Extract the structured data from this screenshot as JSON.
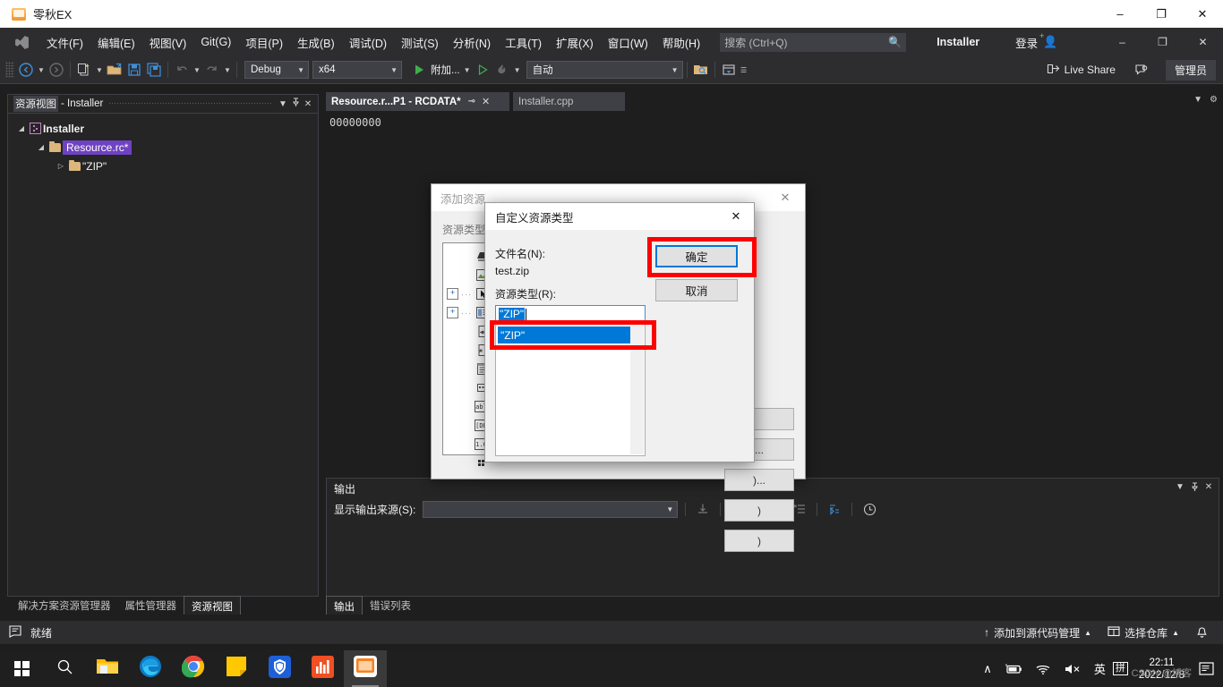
{
  "window": {
    "title": "零秋EX",
    "app_icon": "app-window-icon",
    "minimize": "–",
    "maximize": "❐",
    "close": "✕"
  },
  "menubar": {
    "logo": "visual-studio-logo",
    "items": [
      "文件(F)",
      "编辑(E)",
      "视图(V)",
      "Git(G)",
      "项目(P)",
      "生成(B)",
      "调试(D)",
      "测试(S)",
      "分析(N)",
      "工具(T)",
      "扩展(X)",
      "窗口(W)",
      "帮助(H)"
    ],
    "search_placeholder": "搜索 (Ctrl+Q)",
    "search_icon": "search-icon",
    "project_name": "Installer",
    "signin": "登录",
    "signin_icon": "account-add-icon",
    "minimize": "–",
    "restore": "❐",
    "close": "✕"
  },
  "toolbar": {
    "nav_back_icon": "navigate-back-icon",
    "nav_forward_icon": "navigate-forward-icon",
    "new_item_icon": "new-item-icon",
    "open_file_icon": "open-file-icon",
    "save_icon": "save-icon",
    "save_all_icon": "save-all-icon",
    "undo_icon": "undo-icon",
    "redo_icon": "redo-icon",
    "configuration": "Debug",
    "platform": "x64",
    "start_icon": "start-debug-icon",
    "attach_label": "附加...",
    "start_outline_icon": "start-without-debug-icon",
    "hotreload_icon": "hot-reload-icon",
    "auto_label": "自动",
    "search_folder_icon": "search-folder-icon",
    "window_layout_icon": "window-layout-icon",
    "overflow_icon": "toolbar-overflow-icon",
    "live_share": "Live Share",
    "live_share_icon": "live-share-icon",
    "feedback_icon": "feedback-icon",
    "admin_badge": "管理员"
  },
  "resource_view": {
    "tab_title": "资源视图",
    "tab_suffix": "- Installer",
    "dropdown_icon": "▼",
    "pin_icon": "▮",
    "close_icon": "✕",
    "tree": [
      {
        "label": "Installer",
        "expander": "◢",
        "icon": "project-icon",
        "indent": 0,
        "selected": false,
        "bold": true
      },
      {
        "label": "Resource.rc*",
        "expander": "◢",
        "icon": "folder-icon",
        "indent": 1,
        "selected": true,
        "bold": false
      },
      {
        "label": "\"ZIP\"",
        "expander": "▷",
        "icon": "folder-icon",
        "indent": 2,
        "selected": false,
        "bold": false
      }
    ]
  },
  "editor": {
    "tabs": [
      {
        "label": "Resource.r...P1 - RCDATA*",
        "active": true,
        "pin_icon": "⊸",
        "close_icon": "✕"
      },
      {
        "label": "Installer.cpp",
        "active": false
      }
    ],
    "content": "00000000",
    "caret_icon": "▼",
    "settings_icon": "gear-icon"
  },
  "output_pane": {
    "title": "输出",
    "dropdown_icon": "▼",
    "pin_icon": "▮",
    "close_icon": "✕",
    "source_label": "显示输出来源(S):",
    "source_value": "",
    "caret": "▼",
    "tool_icons": [
      "goto-message-icon",
      "clear-pane-icon",
      "toggle-wordwrap-icon",
      "clear-all-icon",
      "toggle-autoscroll-icon",
      "show-timestamps-icon"
    ]
  },
  "bottom_tabs": {
    "left": [
      {
        "label": "解决方案资源管理器",
        "active": false
      },
      {
        "label": "属性管理器",
        "active": false
      },
      {
        "label": "资源视图",
        "active": true
      }
    ],
    "right": [
      {
        "label": "输出",
        "active": true
      },
      {
        "label": "错误列表",
        "active": false
      }
    ]
  },
  "statusbar": {
    "ready_icon": "status-ready-icon",
    "ready": "就绪",
    "source_control_arrow": "↑",
    "source_control": "添加到源代码管理",
    "source_control_caret": "▲",
    "repo_icon": "repository-icon",
    "repo": "选择仓库",
    "repo_caret": "▲",
    "notification_icon": "bell-icon"
  },
  "add_resource_dialog": {
    "title": "添加资源",
    "close_icon": "✕",
    "resource_type_label": "资源类型",
    "tree_items": [
      {
        "expander": "",
        "dots": "",
        "icon": "accelerator-icon",
        "glyph": "◤"
      },
      {
        "expander": "",
        "dots": "",
        "icon": "bitmap-icon",
        "glyph": "⛰"
      },
      {
        "expander": "+",
        "dots": "···",
        "icon": "cursor-icon",
        "glyph": "➤"
      },
      {
        "expander": "+",
        "dots": "···",
        "icon": "dialog-icon",
        "glyph": "▤"
      },
      {
        "expander": "",
        "dots": "",
        "icon": "html-icon",
        "glyph": "◈"
      },
      {
        "expander": "",
        "dots": "",
        "icon": "icon-icon",
        "glyph": "✶"
      },
      {
        "expander": "",
        "dots": "",
        "icon": "menu-icon",
        "glyph": "≡"
      },
      {
        "expander": "",
        "dots": "",
        "icon": "toolbar-icon",
        "glyph": "⬚"
      },
      {
        "expander": "",
        "dots": "",
        "icon": "string-table-icon",
        "glyph": "abl"
      },
      {
        "expander": "",
        "dots": "",
        "icon": "version-icon",
        "glyph": "[DE"
      },
      {
        "expander": "",
        "dots": "",
        "icon": "numeric-icon",
        "glyph": "1.0"
      },
      {
        "expander": "",
        "dots": "",
        "icon": "custom-icon",
        "glyph": "∷"
      }
    ],
    "buttons": [
      "",
      "...",
      ")...",
      ")",
      ")"
    ]
  },
  "custom_resource_dialog": {
    "title": "自定义资源类型",
    "close_icon": "✕",
    "filename_label": "文件名(N):",
    "filename_value": "test.zip",
    "restype_label": "资源类型(R):",
    "restype_value": "\"ZIP\"",
    "dropdown_items": [
      "\"ZIP\""
    ],
    "ok_button": "确定",
    "cancel_button": "取消"
  },
  "annotations": {
    "highlight_color": "#ff0000",
    "boxes": [
      "ok-button-highlight",
      "dropdown-item-highlight"
    ]
  },
  "taskbar": {
    "items": [
      {
        "name": "start-button",
        "icon": "windows-logo-icon"
      },
      {
        "name": "search-button",
        "icon": "search-icon"
      },
      {
        "name": "file-explorer",
        "icon": "folder-icon"
      },
      {
        "name": "microsoft-edge",
        "icon": "edge-icon"
      },
      {
        "name": "google-chrome",
        "icon": "chrome-icon"
      },
      {
        "name": "sticky-notes",
        "icon": "note-icon"
      },
      {
        "name": "security-app",
        "icon": "shield-icon"
      },
      {
        "name": "chart-app",
        "icon": "bar-chart-icon"
      },
      {
        "name": "visual-studio",
        "icon": "active-window-icon"
      }
    ],
    "tray": {
      "chevron": "∧",
      "battery_icon": "battery-icon",
      "network_icon": "wifi-icon",
      "volume_icon": "volume-mute-icon",
      "ime_lang": "英",
      "ime_mode": "拼",
      "time": "22:11",
      "date": "2022/12/8",
      "action_center_icon": "action-center-icon"
    },
    "watermark": "CSDN @博客"
  }
}
